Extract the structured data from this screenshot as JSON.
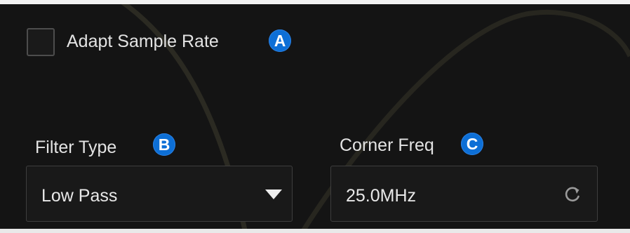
{
  "adapt_sample_rate": {
    "label": "Adapt Sample Rate",
    "checked": false,
    "marker": "A"
  },
  "filter_type": {
    "label": "Filter Type",
    "marker": "B",
    "selected": "Low Pass",
    "icon": "chevron-down-icon"
  },
  "corner_freq": {
    "label": "Corner Freq",
    "marker": "C",
    "value": "25.0MHz",
    "icon": "reset-icon"
  },
  "colors": {
    "background": "#141414",
    "text": "#e3e3e3",
    "field_border": "#3e3e3e",
    "marker_blue": "#0d6fd6",
    "curve": "#6f6b4a"
  }
}
